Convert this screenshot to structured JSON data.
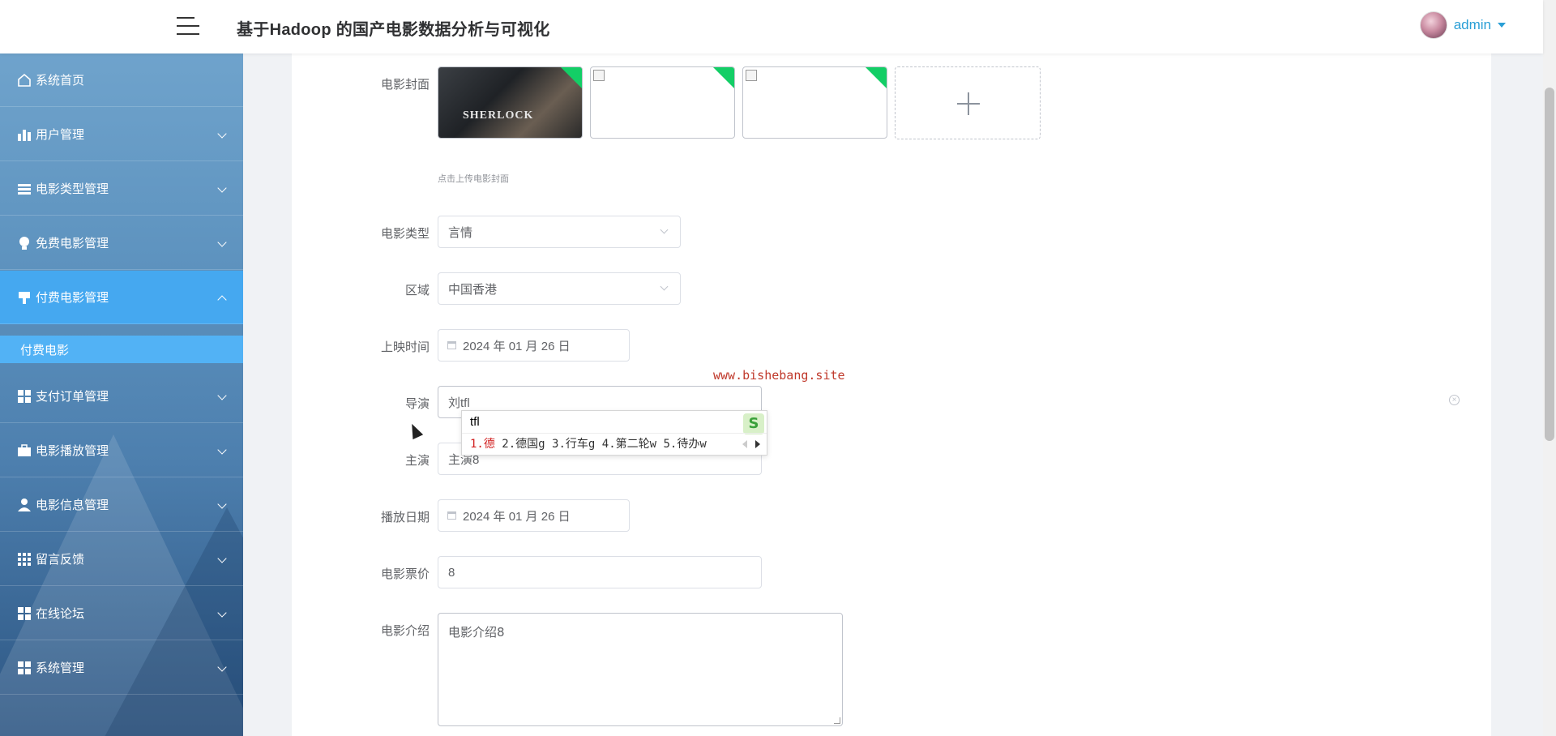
{
  "header": {
    "title": "基于Hadoop 的国产电影数据分析与可视化",
    "username": "admin"
  },
  "sidebar": {
    "items": [
      {
        "label": "系统首页",
        "icon": "home-icon"
      },
      {
        "label": "用户管理",
        "icon": "bar-chart-icon"
      },
      {
        "label": "电影类型管理",
        "icon": "list-icon"
      },
      {
        "label": "免费电影管理",
        "icon": "bulb-icon"
      },
      {
        "label": "付费电影管理",
        "icon": "brush-icon",
        "active": true
      },
      {
        "label": "支付订单管理",
        "icon": "grid-icon"
      },
      {
        "label": "电影播放管理",
        "icon": "briefcase-icon"
      },
      {
        "label": "电影信息管理",
        "icon": "user-icon"
      },
      {
        "label": "留言反馈",
        "icon": "apps-icon"
      },
      {
        "label": "在线论坛",
        "icon": "grid-icon"
      },
      {
        "label": "系统管理",
        "icon": "grid-icon"
      }
    ],
    "submenu": {
      "label": "付费电影"
    }
  },
  "form": {
    "cover": {
      "label": "电影封面",
      "hint": "点击上传电影封面",
      "poster_text": "SHERLOCK"
    },
    "type": {
      "label": "电影类型",
      "value": "言情"
    },
    "region": {
      "label": "区域",
      "value": "中国香港"
    },
    "release_date": {
      "label": "上映时间",
      "value": "2024 年 01 月 26 日"
    },
    "director": {
      "label": "导演",
      "value": "刘tfl"
    },
    "actor": {
      "label": "主演",
      "value": "主演8"
    },
    "play_date": {
      "label": "播放日期",
      "value": "2024 年 01 月 26 日"
    },
    "price": {
      "label": "电影票价",
      "value": "8"
    },
    "intro": {
      "label": "电影介绍",
      "value": "电影介绍8"
    }
  },
  "watermark": "www.bishebang.site",
  "ime": {
    "pinyin": "tfl",
    "candidates": [
      "1.德",
      "2.德国g",
      "3.行车g",
      "4.第二轮w",
      "5.待办w"
    ],
    "logo": "S"
  },
  "colors": {
    "accent": "#2a9fd6",
    "active_menu": "#45a8f0",
    "upload_badge": "#13ce66",
    "watermark": "#c0392b"
  }
}
